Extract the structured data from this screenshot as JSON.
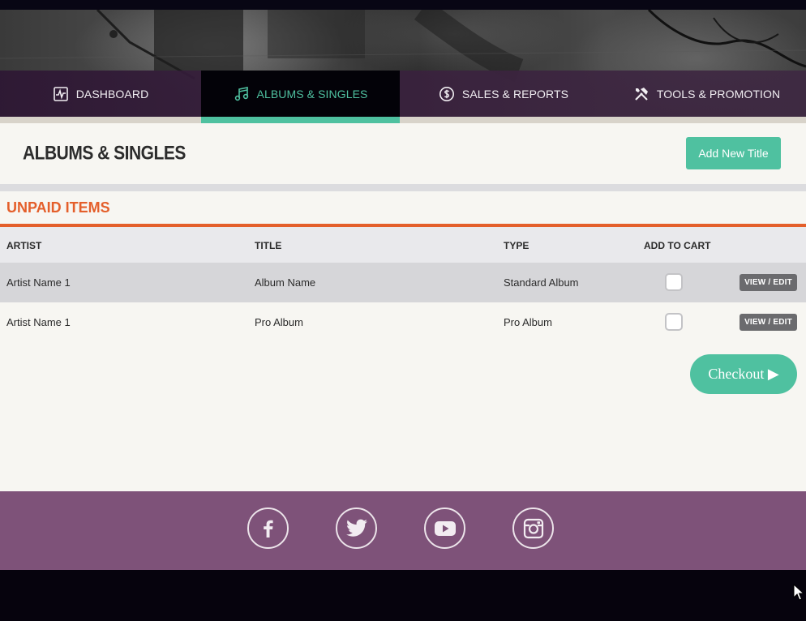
{
  "nav": {
    "tabs": [
      {
        "label": "DASHBOARD",
        "icon": "chart-icon"
      },
      {
        "label": "ALBUMS & SINGLES",
        "icon": "music-note-icon",
        "active": true
      },
      {
        "label": "SALES & REPORTS",
        "icon": "dollar-icon"
      },
      {
        "label": "TOOLS & PROMOTION",
        "icon": "tools-icon"
      }
    ]
  },
  "page": {
    "title": "ALBUMS & SINGLES",
    "add_button": "Add New Title"
  },
  "unpaid": {
    "title": "UNPAID ITEMS",
    "columns": [
      "ARTIST",
      "TITLE",
      "TYPE",
      "ADD TO CART"
    ],
    "rows": [
      {
        "artist": "Artist Name 1",
        "title": "Album Name",
        "type": "Standard Album",
        "in_cart": false,
        "action": "VIEW / EDIT"
      },
      {
        "artist": "Artist Name 1",
        "title": "Pro Album",
        "type": "Pro Album",
        "in_cart": false,
        "action": "VIEW / EDIT"
      }
    ],
    "checkout": "Checkout ▶"
  },
  "footer": {
    "social": [
      "facebook-icon",
      "twitter-icon",
      "youtube-icon",
      "instagram-icon"
    ]
  },
  "colors": {
    "accent": "#4fc1a0",
    "section": "#e45f2b",
    "footer": "#7e5279",
    "nav": "#2e1834"
  }
}
